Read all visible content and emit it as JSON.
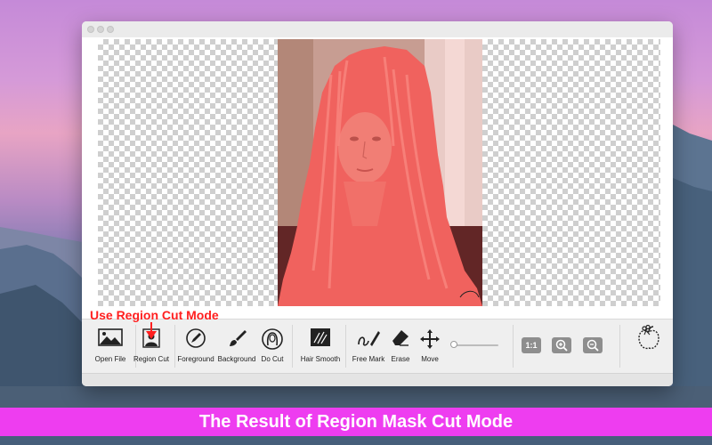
{
  "window": {
    "title_buttons": [
      "close",
      "minimize",
      "zoom"
    ]
  },
  "annotation": {
    "label": "Use Region Cut Mode",
    "color": "#ff1f1f"
  },
  "toolbar": {
    "tools": [
      {
        "label": "Open File",
        "icon": "image-icon"
      },
      {
        "label": "Region Cut",
        "icon": "person-icon"
      },
      {
        "label": "Foreground",
        "icon": "pen-icon"
      },
      {
        "label": "Background",
        "icon": "brush-icon"
      },
      {
        "label": "Do Cut",
        "icon": "face-outline-icon"
      },
      {
        "label": "Hair Smooth",
        "icon": "hair-strokes-icon"
      },
      {
        "label": "Free Mark",
        "icon": "freehand-pen-icon"
      },
      {
        "label": "Erase",
        "icon": "eraser-icon"
      },
      {
        "label": "Move",
        "icon": "move-arrows-icon"
      }
    ],
    "zoom_slider": {
      "value": 0.05
    },
    "actual_size_label": "1:1",
    "zoom_in_icon": "zoom-in-icon",
    "zoom_out_icon": "zoom-out-icon",
    "save_icon": "scissors-apple-icon"
  },
  "banner": {
    "text": "The Result of Region Mask Cut Mode",
    "color": "#ee3df0"
  }
}
